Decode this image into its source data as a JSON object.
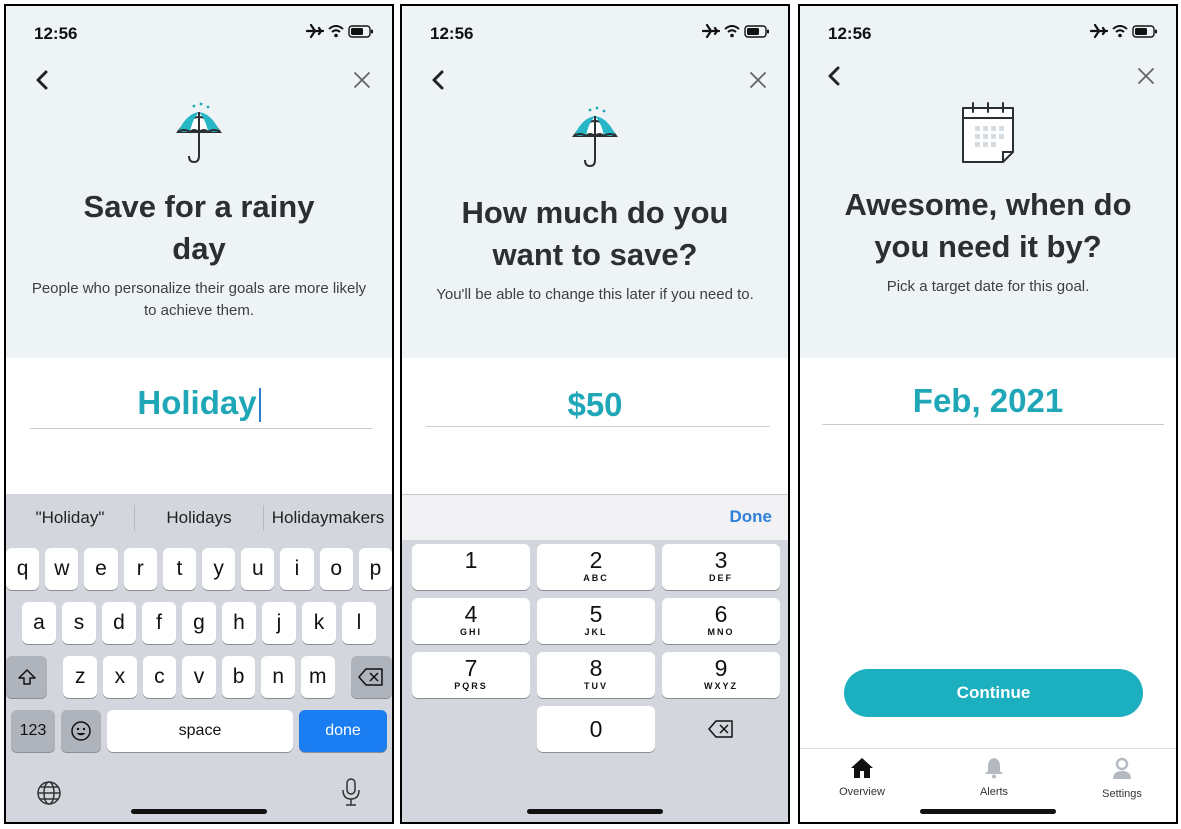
{
  "status": {
    "time": "12:56"
  },
  "screens": {
    "name_goal": {
      "title_line1": "Save for a rainy",
      "title_line2": "day",
      "subtitle": "People who personalize their goals are more likely to achieve them.",
      "input_value": "Holiday",
      "keyboard": {
        "suggestions": [
          "\"Holiday\"",
          "Holidays",
          "Holidaymakers"
        ],
        "row1": [
          "q",
          "w",
          "e",
          "r",
          "t",
          "y",
          "u",
          "i",
          "o",
          "p"
        ],
        "row2": [
          "a",
          "s",
          "d",
          "f",
          "g",
          "h",
          "j",
          "k",
          "l"
        ],
        "row3": [
          "z",
          "x",
          "c",
          "v",
          "b",
          "n",
          "m"
        ],
        "numbers_label": "123",
        "space_label": "space",
        "done_label": "done"
      }
    },
    "amount": {
      "title_line1": "How much do you",
      "title_line2": "want to save?",
      "subtitle": "You'll be able to change this later if you need to.",
      "input_value": "$50",
      "done_label": "Done",
      "numpad": [
        {
          "digit": "1",
          "letters": ""
        },
        {
          "digit": "2",
          "letters": "ABC"
        },
        {
          "digit": "3",
          "letters": "DEF"
        },
        {
          "digit": "4",
          "letters": "GHI"
        },
        {
          "digit": "5",
          "letters": "JKL"
        },
        {
          "digit": "6",
          "letters": "MNO"
        },
        {
          "digit": "7",
          "letters": "PQRS"
        },
        {
          "digit": "8",
          "letters": "TUV"
        },
        {
          "digit": "9",
          "letters": "WXYZ"
        },
        {
          "digit": "0",
          "letters": ""
        }
      ]
    },
    "date": {
      "title_line1": "Awesome, when do",
      "title_line2": "you need it by?",
      "subtitle": "Pick a target date for this goal.",
      "date_value": "Feb, 2021",
      "continue_label": "Continue",
      "tabs": [
        {
          "label": "Overview",
          "icon": "home-icon"
        },
        {
          "label": "Alerts",
          "icon": "bell-icon"
        },
        {
          "label": "Settings",
          "icon": "person-icon"
        }
      ]
    }
  },
  "colors": {
    "accent": "#1fa7b8",
    "button": "#1bafc0",
    "hero_bg": "#eef3f6",
    "key_blue": "#1a7df2"
  }
}
